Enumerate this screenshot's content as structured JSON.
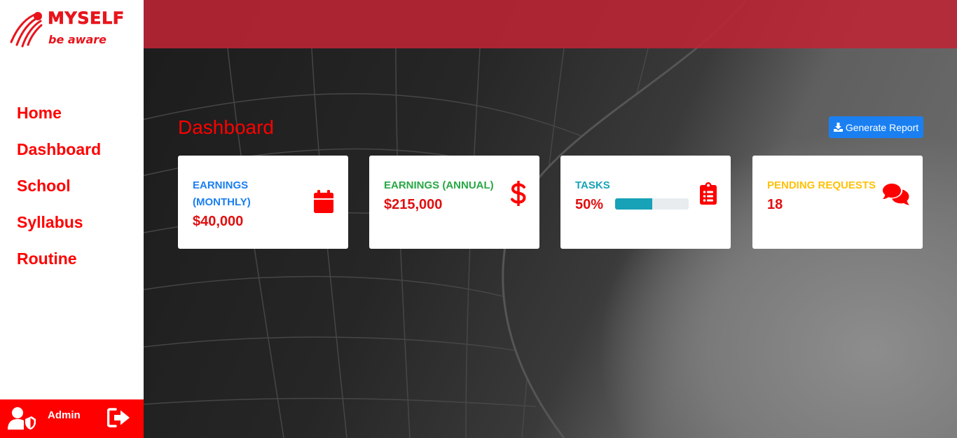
{
  "brand": {
    "title": "MYSELF",
    "tagline": "be aware",
    "color": "#e8141c"
  },
  "sidebar": {
    "items": [
      {
        "label": "Home"
      },
      {
        "label": "Dashboard"
      },
      {
        "label": "School"
      },
      {
        "label": "Syllabus"
      },
      {
        "label": "Routine"
      }
    ]
  },
  "user": {
    "name": "Admin",
    "icon": "user-shield-icon",
    "logout_icon": "sign-out-icon"
  },
  "header": {
    "title": "Dashboard",
    "generate_report_label": "Generate Report",
    "generate_report_icon": "download-icon"
  },
  "cards": [
    {
      "label": "Earnings (Monthly)",
      "label_line1": "EARNINGS",
      "label_line2": "(MONTHLY)",
      "value": "$40,000",
      "label_color": "#1a7ff0",
      "icon": "calendar-icon"
    },
    {
      "label": "Earnings (Annual)",
      "value": "$215,000",
      "label_color": "#28a745",
      "icon": "dollar-icon"
    },
    {
      "label": "Tasks",
      "value": "50%",
      "progress": 0.5,
      "label_color": "#17a2b8",
      "icon": "clipboard-list-icon"
    },
    {
      "label": "Pending Requests",
      "value": "18",
      "label_color": "#ffc107",
      "icon": "comments-icon"
    }
  ],
  "colors": {
    "accent_red": "#ff0000",
    "topbar": "#be2434",
    "button_blue": "#1a80f2",
    "progress_fill": "#17a2b8"
  }
}
